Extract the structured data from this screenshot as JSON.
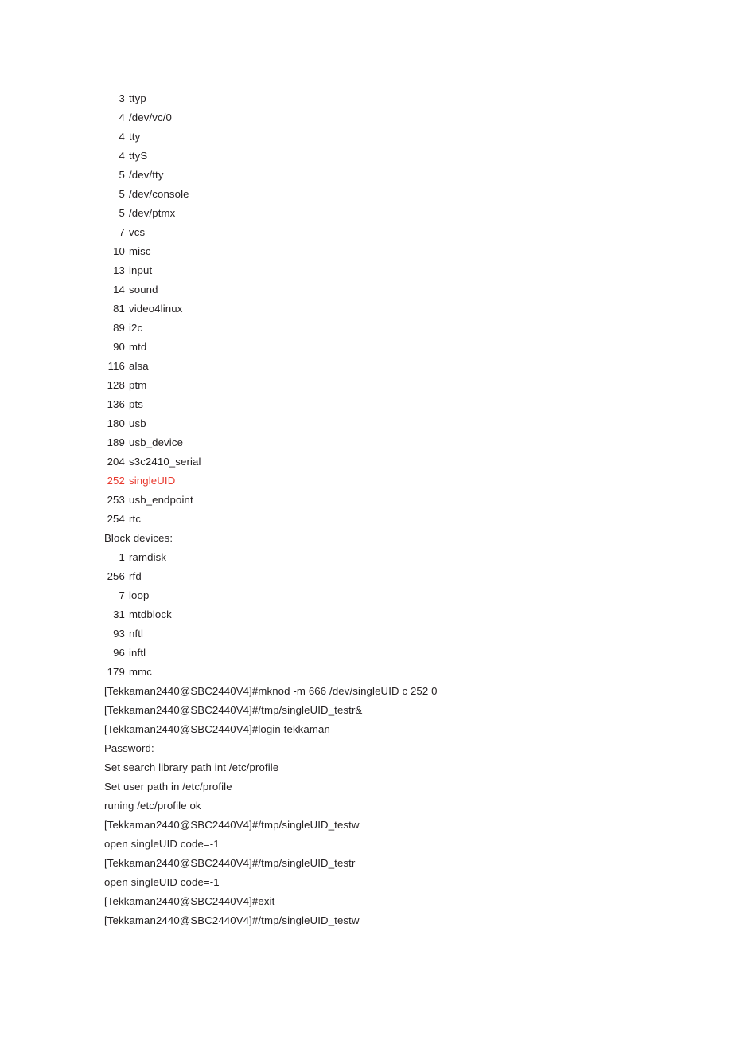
{
  "page": {
    "background_color": "#ffffff",
    "text_color": "#231f20",
    "highlight_color": "#e8372c"
  },
  "console": {
    "lines": [
      {
        "type": "device",
        "num": "3",
        "name": "ttyp",
        "color": "default"
      },
      {
        "type": "device",
        "num": "4",
        "name": "/dev/vc/0",
        "color": "default"
      },
      {
        "type": "device",
        "num": "4",
        "name": "tty",
        "color": "default"
      },
      {
        "type": "device",
        "num": "4",
        "name": "ttyS",
        "color": "default"
      },
      {
        "type": "device",
        "num": "5",
        "name": "/dev/tty",
        "color": "default"
      },
      {
        "type": "device",
        "num": "5",
        "name": "/dev/console",
        "color": "default"
      },
      {
        "type": "device",
        "num": "5",
        "name": "/dev/ptmx",
        "color": "default"
      },
      {
        "type": "device",
        "num": "7",
        "name": "vcs",
        "color": "default"
      },
      {
        "type": "device",
        "num": "10",
        "name": "misc",
        "color": "default"
      },
      {
        "type": "device",
        "num": "13",
        "name": "input",
        "color": "default"
      },
      {
        "type": "device",
        "num": "14",
        "name": "sound",
        "color": "default"
      },
      {
        "type": "device",
        "num": "81",
        "name": "video4linux",
        "color": "default"
      },
      {
        "type": "device",
        "num": "89",
        "name": "i2c",
        "color": "default"
      },
      {
        "type": "device",
        "num": "90",
        "name": "mtd",
        "color": "default"
      },
      {
        "type": "device",
        "num": "116",
        "name": "alsa",
        "color": "default"
      },
      {
        "type": "device",
        "num": "128",
        "name": "ptm",
        "color": "default"
      },
      {
        "type": "device",
        "num": "136",
        "name": "pts",
        "color": "default"
      },
      {
        "type": "device",
        "num": "180",
        "name": "usb",
        "color": "default"
      },
      {
        "type": "device",
        "num": "189",
        "name": "usb_device",
        "color": "default"
      },
      {
        "type": "device",
        "num": "204",
        "name": "s3c2410_serial",
        "color": "default"
      },
      {
        "type": "device",
        "num": "252",
        "name": "singleUID",
        "color": "red"
      },
      {
        "type": "device",
        "num": "253",
        "name": "usb_endpoint",
        "color": "default"
      },
      {
        "type": "device",
        "num": "254",
        "name": "rtc",
        "color": "default"
      },
      {
        "type": "text",
        "text": "Block devices:",
        "color": "default"
      },
      {
        "type": "device",
        "num": "1",
        "name": "ramdisk",
        "color": "default"
      },
      {
        "type": "device",
        "num": "256",
        "name": "rfd",
        "color": "default"
      },
      {
        "type": "device",
        "num": "7",
        "name": "loop",
        "color": "default"
      },
      {
        "type": "device",
        "num": "31",
        "name": "mtdblock",
        "color": "default"
      },
      {
        "type": "device",
        "num": "93",
        "name": "nftl",
        "color": "default"
      },
      {
        "type": "device",
        "num": "96",
        "name": "inftl",
        "color": "default"
      },
      {
        "type": "device",
        "num": "179",
        "name": "mmc",
        "color": "default"
      },
      {
        "type": "text",
        "text": "[Tekkaman2440@SBC2440V4]#mknod -m 666 /dev/singleUID c 252 0",
        "color": "default"
      },
      {
        "type": "text",
        "text": "[Tekkaman2440@SBC2440V4]#/tmp/singleUID_testr&",
        "color": "default"
      },
      {
        "type": "text",
        "text": "[Tekkaman2440@SBC2440V4]#login tekkaman",
        "color": "default"
      },
      {
        "type": "text",
        "text": "Password:",
        "color": "default"
      },
      {
        "type": "text",
        "text": "Set search library path int /etc/profile",
        "color": "default"
      },
      {
        "type": "text",
        "text": "Set user path in /etc/profile",
        "color": "default"
      },
      {
        "type": "text",
        "text": "runing /etc/profile ok",
        "color": "default"
      },
      {
        "type": "text",
        "text": "[Tekkaman2440@SBC2440V4]#/tmp/singleUID_testw",
        "color": "default"
      },
      {
        "type": "text",
        "text": "open singleUID code=-1",
        "color": "default"
      },
      {
        "type": "text",
        "text": "[Tekkaman2440@SBC2440V4]#/tmp/singleUID_testr",
        "color": "default"
      },
      {
        "type": "text",
        "text": "open singleUID code=-1",
        "color": "default"
      },
      {
        "type": "text",
        "text": "[Tekkaman2440@SBC2440V4]#exit",
        "color": "default"
      },
      {
        "type": "text",
        "text": "[Tekkaman2440@SBC2440V4]#/tmp/singleUID_testw",
        "color": "default"
      }
    ]
  }
}
